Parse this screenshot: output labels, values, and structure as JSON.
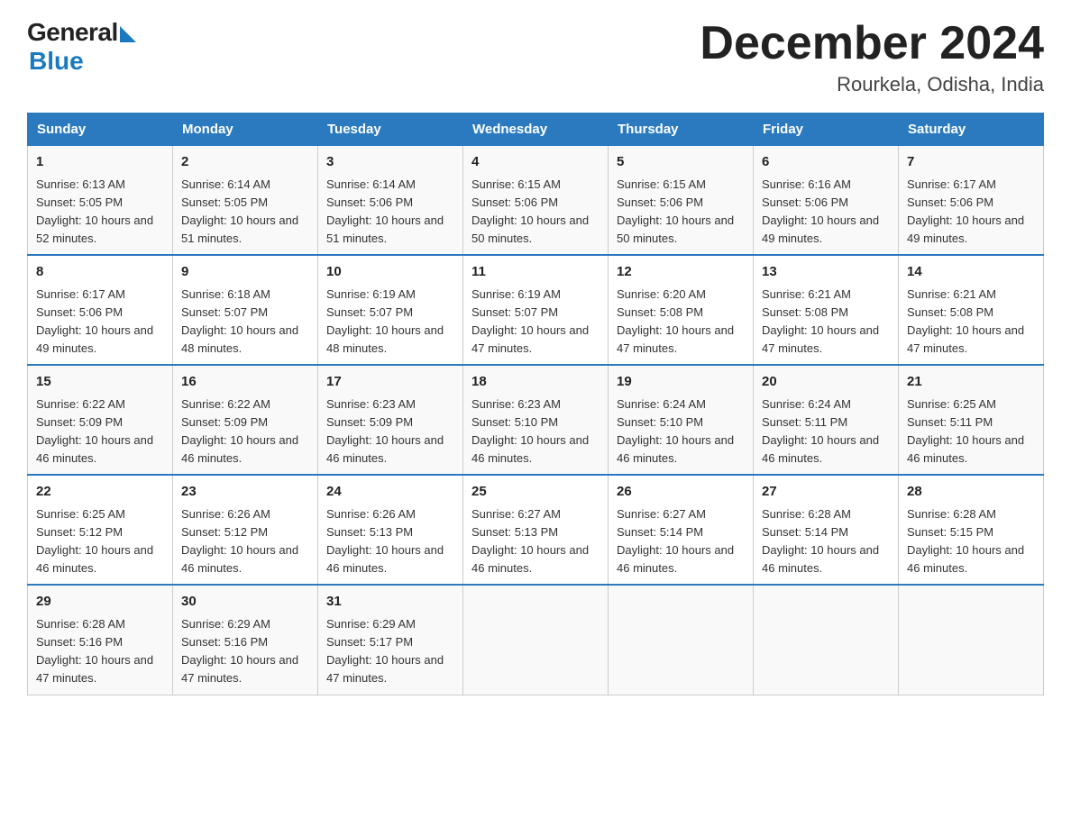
{
  "header": {
    "logo_general": "General",
    "logo_blue": "Blue",
    "title": "December 2024",
    "subtitle": "Rourkela, Odisha, India"
  },
  "days_of_week": [
    "Sunday",
    "Monday",
    "Tuesday",
    "Wednesday",
    "Thursday",
    "Friday",
    "Saturday"
  ],
  "weeks": [
    [
      {
        "num": "1",
        "sunrise": "6:13 AM",
        "sunset": "5:05 PM",
        "daylight": "10 hours and 52 minutes."
      },
      {
        "num": "2",
        "sunrise": "6:14 AM",
        "sunset": "5:05 PM",
        "daylight": "10 hours and 51 minutes."
      },
      {
        "num": "3",
        "sunrise": "6:14 AM",
        "sunset": "5:06 PM",
        "daylight": "10 hours and 51 minutes."
      },
      {
        "num": "4",
        "sunrise": "6:15 AM",
        "sunset": "5:06 PM",
        "daylight": "10 hours and 50 minutes."
      },
      {
        "num": "5",
        "sunrise": "6:15 AM",
        "sunset": "5:06 PM",
        "daylight": "10 hours and 50 minutes."
      },
      {
        "num": "6",
        "sunrise": "6:16 AM",
        "sunset": "5:06 PM",
        "daylight": "10 hours and 49 minutes."
      },
      {
        "num": "7",
        "sunrise": "6:17 AM",
        "sunset": "5:06 PM",
        "daylight": "10 hours and 49 minutes."
      }
    ],
    [
      {
        "num": "8",
        "sunrise": "6:17 AM",
        "sunset": "5:06 PM",
        "daylight": "10 hours and 49 minutes."
      },
      {
        "num": "9",
        "sunrise": "6:18 AM",
        "sunset": "5:07 PM",
        "daylight": "10 hours and 48 minutes."
      },
      {
        "num": "10",
        "sunrise": "6:19 AM",
        "sunset": "5:07 PM",
        "daylight": "10 hours and 48 minutes."
      },
      {
        "num": "11",
        "sunrise": "6:19 AM",
        "sunset": "5:07 PM",
        "daylight": "10 hours and 47 minutes."
      },
      {
        "num": "12",
        "sunrise": "6:20 AM",
        "sunset": "5:08 PM",
        "daylight": "10 hours and 47 minutes."
      },
      {
        "num": "13",
        "sunrise": "6:21 AM",
        "sunset": "5:08 PM",
        "daylight": "10 hours and 47 minutes."
      },
      {
        "num": "14",
        "sunrise": "6:21 AM",
        "sunset": "5:08 PM",
        "daylight": "10 hours and 47 minutes."
      }
    ],
    [
      {
        "num": "15",
        "sunrise": "6:22 AM",
        "sunset": "5:09 PM",
        "daylight": "10 hours and 46 minutes."
      },
      {
        "num": "16",
        "sunrise": "6:22 AM",
        "sunset": "5:09 PM",
        "daylight": "10 hours and 46 minutes."
      },
      {
        "num": "17",
        "sunrise": "6:23 AM",
        "sunset": "5:09 PM",
        "daylight": "10 hours and 46 minutes."
      },
      {
        "num": "18",
        "sunrise": "6:23 AM",
        "sunset": "5:10 PM",
        "daylight": "10 hours and 46 minutes."
      },
      {
        "num": "19",
        "sunrise": "6:24 AM",
        "sunset": "5:10 PM",
        "daylight": "10 hours and 46 minutes."
      },
      {
        "num": "20",
        "sunrise": "6:24 AM",
        "sunset": "5:11 PM",
        "daylight": "10 hours and 46 minutes."
      },
      {
        "num": "21",
        "sunrise": "6:25 AM",
        "sunset": "5:11 PM",
        "daylight": "10 hours and 46 minutes."
      }
    ],
    [
      {
        "num": "22",
        "sunrise": "6:25 AM",
        "sunset": "5:12 PM",
        "daylight": "10 hours and 46 minutes."
      },
      {
        "num": "23",
        "sunrise": "6:26 AM",
        "sunset": "5:12 PM",
        "daylight": "10 hours and 46 minutes."
      },
      {
        "num": "24",
        "sunrise": "6:26 AM",
        "sunset": "5:13 PM",
        "daylight": "10 hours and 46 minutes."
      },
      {
        "num": "25",
        "sunrise": "6:27 AM",
        "sunset": "5:13 PM",
        "daylight": "10 hours and 46 minutes."
      },
      {
        "num": "26",
        "sunrise": "6:27 AM",
        "sunset": "5:14 PM",
        "daylight": "10 hours and 46 minutes."
      },
      {
        "num": "27",
        "sunrise": "6:28 AM",
        "sunset": "5:14 PM",
        "daylight": "10 hours and 46 minutes."
      },
      {
        "num": "28",
        "sunrise": "6:28 AM",
        "sunset": "5:15 PM",
        "daylight": "10 hours and 46 minutes."
      }
    ],
    [
      {
        "num": "29",
        "sunrise": "6:28 AM",
        "sunset": "5:16 PM",
        "daylight": "10 hours and 47 minutes."
      },
      {
        "num": "30",
        "sunrise": "6:29 AM",
        "sunset": "5:16 PM",
        "daylight": "10 hours and 47 minutes."
      },
      {
        "num": "31",
        "sunrise": "6:29 AM",
        "sunset": "5:17 PM",
        "daylight": "10 hours and 47 minutes."
      },
      null,
      null,
      null,
      null
    ]
  ]
}
